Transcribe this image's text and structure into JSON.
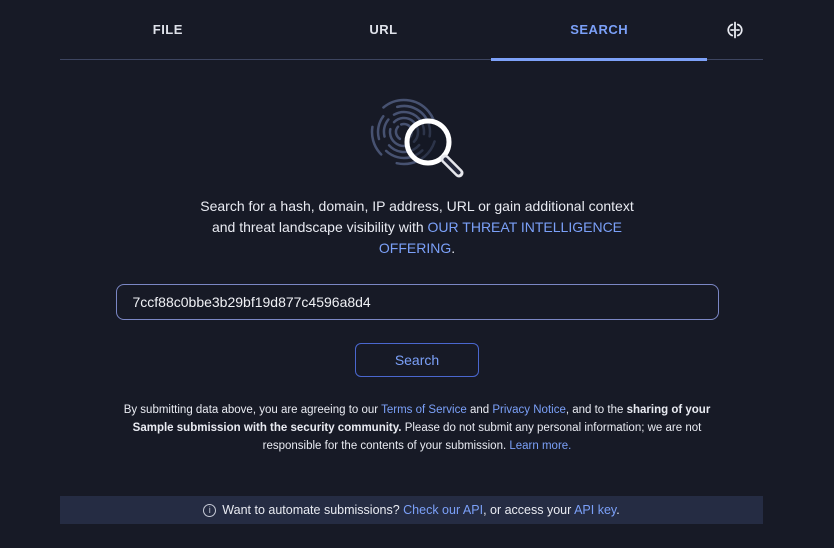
{
  "theme": {
    "background": "#171a26",
    "banner_background": "#252c43",
    "accent_blue": "#7ba0f8",
    "text_white": "#e9ebf2"
  },
  "tabs": {
    "items": [
      {
        "label": "FILE",
        "active": false
      },
      {
        "label": "URL",
        "active": false
      },
      {
        "label": "SEARCH",
        "active": true
      }
    ],
    "hotkeys_icon": "keyboard-shortcuts"
  },
  "hero": {
    "icon": "fingerprint-magnifier",
    "description": {
      "line1": "Search for a hash, domain, IP address, URL or gain additional context",
      "line2_text": "and threat landscape visibility with ",
      "link_text_line2": "OUR THREAT INTELLIGENCE",
      "link_text_line3": "OFFERING",
      "after_link": "."
    }
  },
  "search": {
    "input_value": "7ccf88c0bbe3b29bf19d877c4596a8d4",
    "button_label": "Search"
  },
  "legal": {
    "segments": [
      {
        "text": "By submitting data above, you are agreeing to our ",
        "style": "normal",
        "name": "legal-text"
      },
      {
        "text": "Terms of Service",
        "style": "link",
        "name": "terms-of-service-link"
      },
      {
        "text": " and ",
        "style": "normal",
        "name": "legal-text"
      },
      {
        "text": "Privacy Notice",
        "style": "link",
        "name": "privacy-notice-link"
      },
      {
        "text": ", and to the ",
        "style": "normal",
        "name": "legal-text"
      },
      {
        "text": "sharing of your Sample submission with the security community.",
        "style": "bold",
        "name": "legal-bold-text"
      },
      {
        "text": " Please do not submit any personal information; we are not responsible for the contents of your submission. ",
        "style": "normal",
        "name": "legal-text"
      },
      {
        "text": "Learn more.",
        "style": "link",
        "name": "learn-more-link"
      }
    ]
  },
  "banner": {
    "info_icon_glyph": "i",
    "segments": [
      {
        "text": "Want to automate submissions? ",
        "style": "normal",
        "name": "banner-text"
      },
      {
        "text": "Check our API",
        "style": "link",
        "name": "check-our-api-link"
      },
      {
        "text": ", or access your ",
        "style": "normal",
        "name": "banner-text"
      },
      {
        "text": "API key",
        "style": "link",
        "name": "api-key-link"
      },
      {
        "text": ".",
        "style": "normal",
        "name": "banner-text"
      }
    ]
  }
}
